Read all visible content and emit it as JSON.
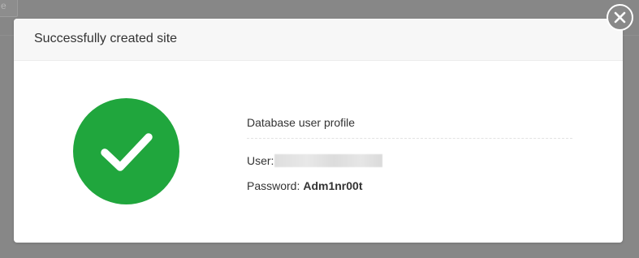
{
  "background": {
    "input_fragment": "e"
  },
  "modal": {
    "title": "Successfully created site",
    "status_icon": "checkmark-circle-icon",
    "close_icon": "close-icon",
    "colors": {
      "success": "#20a63d",
      "header_bg": "#f7f7f7",
      "overlay": "#878787"
    },
    "profile": {
      "title": "Database user profile",
      "user_label": "User:",
      "user_value_redacted": true,
      "password_label": "Password:",
      "password_value": "Adm1nr00t"
    }
  }
}
